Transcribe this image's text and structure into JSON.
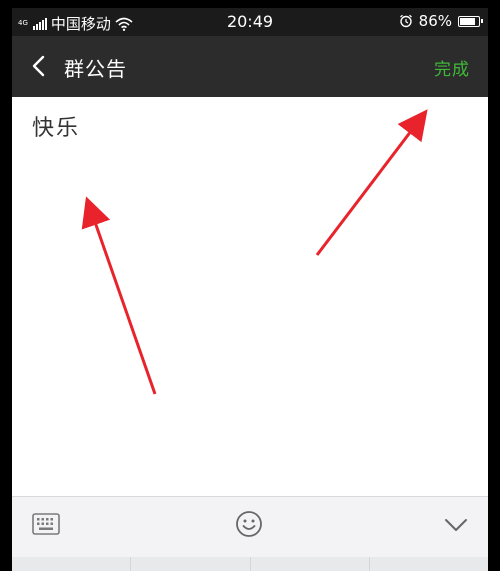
{
  "status_bar": {
    "network_type": "4G",
    "carrier": "中国移动",
    "time": "20:49",
    "battery_percent": "86%",
    "battery_level": 0.86
  },
  "nav": {
    "title": "群公告",
    "done_label": "完成",
    "done_color": "#3fb838"
  },
  "content": {
    "announcement_text": "快乐"
  },
  "toolbar": {
    "icons": [
      "keyboard-icon",
      "emoji-icon",
      "chevron-down-icon"
    ]
  },
  "annotation": {
    "arrow_color": "#e8232b"
  }
}
